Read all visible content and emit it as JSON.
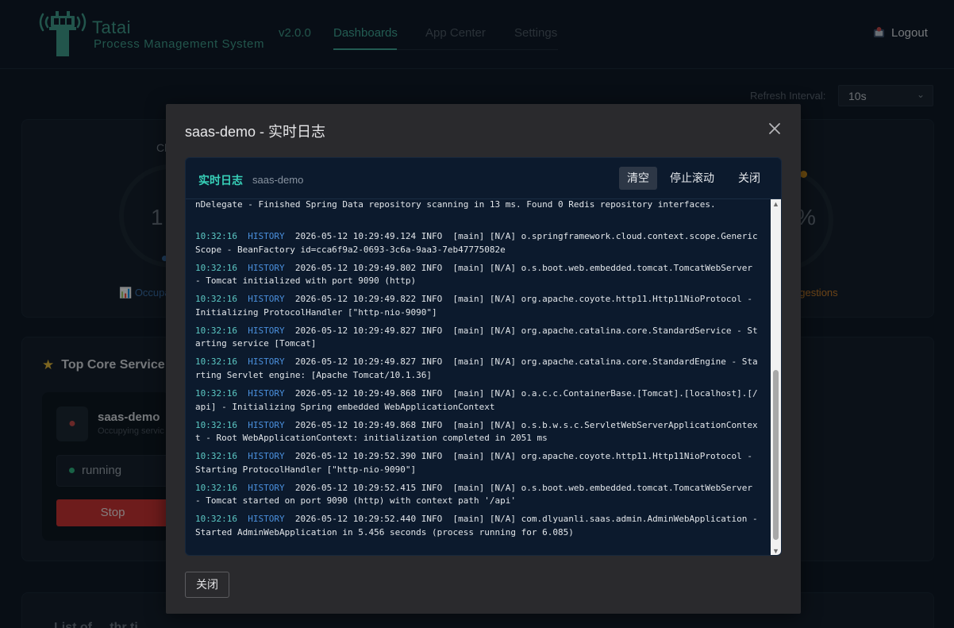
{
  "header": {
    "brand_name": "Tatai",
    "brand_sub": "Process Management System",
    "version": "v2.0.0",
    "nav": [
      "Dashboards",
      "App Center",
      "Settings"
    ],
    "active_nav": "Dashboards",
    "logout": "Logout"
  },
  "background": {
    "refresh_label": "Refresh Interval:",
    "refresh_value": "10s",
    "fragments": {
      "cl": "Cl",
      "one": "1",
      "pct": "%",
      "occupancy": "Occupa",
      "suggestions": "ggestions",
      "list_title": "List of ... thr ti"
    },
    "top_core": {
      "title": "Top Core Service",
      "service_name": "saas-demo",
      "service_sub": "Occupying servic",
      "status": "running",
      "stop_label": "Stop"
    }
  },
  "modal": {
    "title": "saas-demo - 实时日志",
    "log_panel": {
      "title": "实时日志",
      "app": "saas-demo",
      "clear_label": "清空",
      "stop_scroll_label": "停止滚动",
      "close_label": "关闭"
    },
    "first_line": "nDelegate - Finished Spring Data repository scanning in 13 ms. Found 0 Redis repository interfaces.",
    "logs": [
      {
        "time": "10:32:16",
        "source": "HISTORY",
        "message": "2026-05-12 10:29:49.124 INFO  [main] [N/A] o.springframework.cloud.context.scope.GenericScope - BeanFactory id=cca6f9a2-0693-3c6a-9aa3-7eb47775082e"
      },
      {
        "time": "10:32:16",
        "source": "HISTORY",
        "message": "2026-05-12 10:29:49.802 INFO  [main] [N/A] o.s.boot.web.embedded.tomcat.TomcatWebServer - Tomcat initialized with port 9090 (http)"
      },
      {
        "time": "10:32:16",
        "source": "HISTORY",
        "message": "2026-05-12 10:29:49.822 INFO  [main] [N/A] org.apache.coyote.http11.Http11NioProtocol - Initializing ProtocolHandler [\"http-nio-9090\"]"
      },
      {
        "time": "10:32:16",
        "source": "HISTORY",
        "message": "2026-05-12 10:29:49.827 INFO  [main] [N/A] org.apache.catalina.core.StandardService - Starting service [Tomcat]"
      },
      {
        "time": "10:32:16",
        "source": "HISTORY",
        "message": "2026-05-12 10:29:49.827 INFO  [main] [N/A] org.apache.catalina.core.StandardEngine - Starting Servlet engine: [Apache Tomcat/10.1.36]"
      },
      {
        "time": "10:32:16",
        "source": "HISTORY",
        "message": "2026-05-12 10:29:49.868 INFO  [main] [N/A] o.a.c.c.ContainerBase.[Tomcat].[localhost].[/api] - Initializing Spring embedded WebApplicationContext"
      },
      {
        "time": "10:32:16",
        "source": "HISTORY",
        "message": "2026-05-12 10:29:49.868 INFO  [main] [N/A] o.s.b.w.s.c.ServletWebServerApplicationContext - Root WebApplicationContext: initialization completed in 2051 ms"
      },
      {
        "time": "10:32:16",
        "source": "HISTORY",
        "message": "2026-05-12 10:29:52.390 INFO  [main] [N/A] org.apache.coyote.http11.Http11NioProtocol - Starting ProtocolHandler [\"http-nio-9090\"]"
      },
      {
        "time": "10:32:16",
        "source": "HISTORY",
        "message": "2026-05-12 10:29:52.415 INFO  [main] [N/A] o.s.boot.web.embedded.tomcat.TomcatWebServer - Tomcat started on port 9090 (http) with context path '/api'"
      },
      {
        "time": "10:32:16",
        "source": "HISTORY",
        "message": "2026-05-12 10:29:52.440 INFO  [main] [N/A] com.dlyuanli.saas.admin.AdminWebApplication - Started AdminWebApplication in 5.456 seconds (process running for 6.085)"
      }
    ],
    "footer_close_label": "关闭"
  },
  "colors": {
    "accent": "#3fa796",
    "log_bg": "#0c1a2d",
    "timestamp": "#5cc8c4",
    "source_tag": "#4a8fdc",
    "stop_button": "#c93434"
  },
  "icons": {
    "logo": "control-tower-icon",
    "logout": "logout-icon",
    "close": "close-icon",
    "star": "star-icon",
    "select": "chevron-down-icon"
  }
}
